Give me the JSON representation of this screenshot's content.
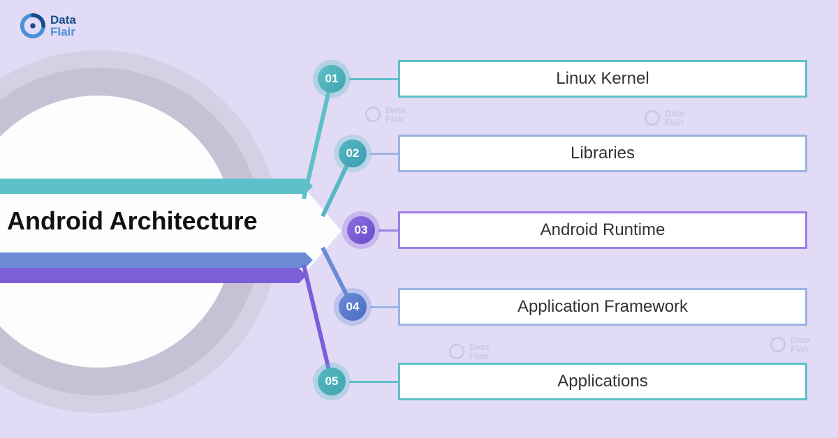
{
  "logo": {
    "line1": "Data",
    "line2": "Flair"
  },
  "title": "Android Architecture",
  "items": [
    {
      "num": "01",
      "label": "Linux Kernel"
    },
    {
      "num": "02",
      "label": "Libraries"
    },
    {
      "num": "03",
      "label": "Android Runtime"
    },
    {
      "num": "04",
      "label": "Application Framework"
    },
    {
      "num": "05",
      "label": "Applications"
    }
  ]
}
